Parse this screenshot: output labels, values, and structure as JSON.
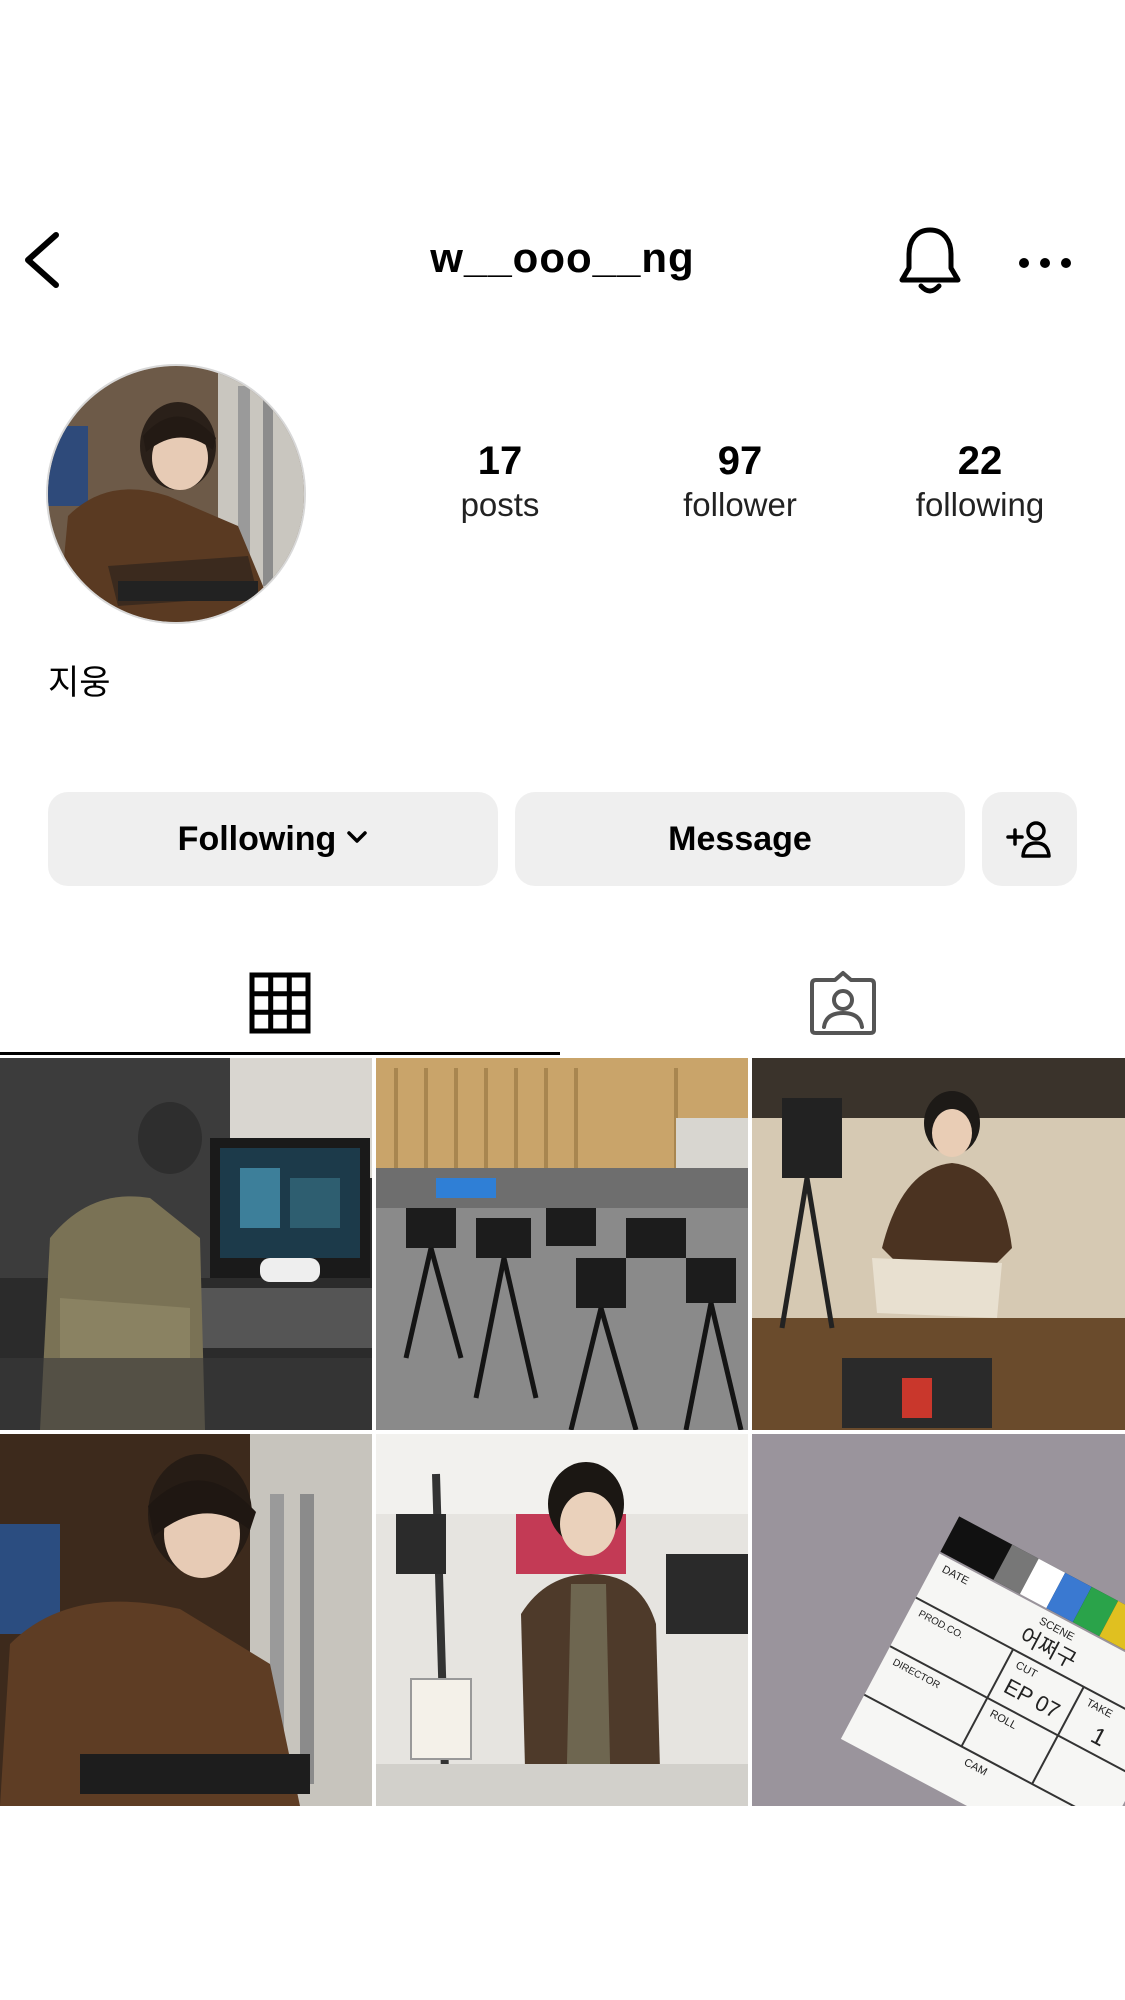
{
  "header": {
    "username": "w__ooo__ng",
    "icons": [
      "chevron-left-icon",
      "bell-icon",
      "more-horizontal-icon"
    ]
  },
  "profile": {
    "display_name": "지웅",
    "stats": [
      {
        "value": "17",
        "label": "posts"
      },
      {
        "value": "97",
        "label": "follower"
      },
      {
        "value": "22",
        "label": "following"
      }
    ]
  },
  "actions": {
    "following_label": "Following",
    "message_label": "Message",
    "add_user_icon": "add-user-icon"
  },
  "tabs": {
    "active": "grid",
    "items": [
      "grid-icon",
      "tagged-person-icon"
    ]
  },
  "grid": {
    "post_count_visible": 6,
    "clapper": {
      "scene_label": "SCENE",
      "cut_label": "CUT",
      "take_label": "TAKE",
      "roll_label": "ROLL",
      "date_label": "DATE",
      "prod_label": "PROD.CO.",
      "director_label": "DIRECTOR",
      "camera_label": "CAM",
      "scene_value": "어쩌구",
      "cut_value": "EP 07",
      "take_value": "1"
    }
  },
  "colors": {
    "button_bg": "#efefef",
    "text": "#000000"
  }
}
